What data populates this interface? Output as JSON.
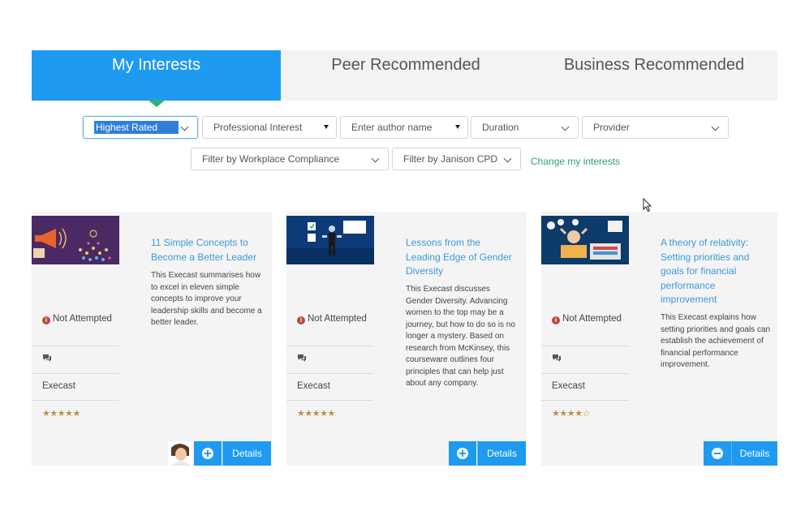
{
  "tabs": [
    {
      "label": "My Interests",
      "active": true
    },
    {
      "label": "Peer Recommended",
      "active": false
    },
    {
      "label": "Business Recommended",
      "active": false
    }
  ],
  "filters": {
    "sort": "Highest Rated",
    "professional_interest": "Professional Interest",
    "author_placeholder": "Enter author name",
    "duration": "Duration",
    "provider": "Provider",
    "workplace_compliance": "Filter by Workplace Compliance",
    "janison_cpd": "Filter by Janison CPD",
    "change_interests": "Change my interests"
  },
  "cards": [
    {
      "title": "11 Simple Concepts to Become a Better Leader",
      "description": "This Execast summarises how to excel in eleven simple concepts to improve your leadership skills and become a better leader.",
      "status": "Not Attempted",
      "type": "Execast",
      "rating": 5,
      "stars": "★★★★★",
      "action_icon": "plus-circle-icon",
      "details_label": "Details"
    },
    {
      "title": "Lessons from the Leading Edge of Gender Diversity",
      "description": "This Execast discusses Gender Diversity. Advancing women to the top may be a journey, but how to do so is no longer a mystery. Based on research from McKinsey, this courseware outlines four principles that can help just about any company.",
      "status": "Not Attempted",
      "type": "Execast",
      "rating": 5,
      "stars": "★★★★★",
      "action_icon": "plus-circle-icon",
      "details_label": "Details"
    },
    {
      "title": "A theory of relativity: Setting priorities and goals for financial performance improvement",
      "description": "This Execast explains how setting priorities and goals can establish the achievement of financial performance improvement.",
      "status": "Not Attempted",
      "type": "Execast",
      "rating": 4,
      "stars": "★★★★☆",
      "action_icon": "minus-circle-icon",
      "details_label": "Details"
    }
  ],
  "colors": {
    "accent": "#1e9bf0",
    "link_green": "#2ba36f",
    "status_red": "#b94a3c",
    "star_gold": "#b89048"
  }
}
